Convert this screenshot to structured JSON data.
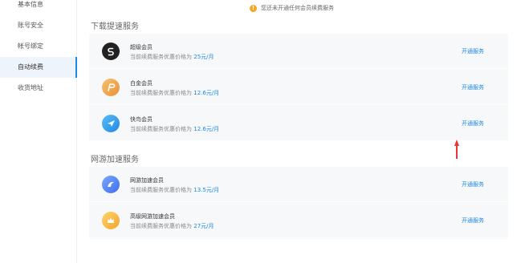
{
  "sidebar": {
    "items": [
      {
        "label": "基本信息",
        "active": false
      },
      {
        "label": "账号安全",
        "active": false
      },
      {
        "label": "帐号绑定",
        "active": false
      },
      {
        "label": "自动续费",
        "active": true
      },
      {
        "label": "收货地址",
        "active": false
      }
    ]
  },
  "notice": {
    "icon": "warning-icon",
    "text": "您还未开通任何会员续费服务"
  },
  "download_section": {
    "title": "下载提速服务",
    "rows": [
      {
        "name": "超级会员",
        "desc_prefix": "当前续费服务优惠价格为 ",
        "price": "25元/月",
        "action": "开通服务",
        "icon": "super-member-icon",
        "color": "#222222"
      },
      {
        "name": "白金会员",
        "desc_prefix": "当前续费服务优惠价格为 ",
        "price": "12.6元/月",
        "action": "开通服务",
        "icon": "platinum-member-icon",
        "color": "#f0a040"
      },
      {
        "name": "快鸟会员",
        "desc_prefix": "当前续费服务优惠价格为 ",
        "price": "12.6元/月",
        "action": "开通服务",
        "icon": "kuainiao-member-icon",
        "color": "#2e9cf0"
      }
    ]
  },
  "game_section": {
    "title": "网游加速服务",
    "rows": [
      {
        "name": "网游加速会员",
        "desc_prefix": "当前续费服务优惠价格为 ",
        "price": "13.5元/月",
        "action": "开通服务",
        "icon": "game-accel-icon",
        "color": "#4a7ff0"
      },
      {
        "name": "高级网游加速会员",
        "desc_prefix": "当前续费服务优惠价格为 ",
        "price": "27元/月",
        "action": "开通服务",
        "icon": "premium-game-accel-icon",
        "color": "#f5b940"
      }
    ]
  },
  "annotation": {
    "color": "#e53935",
    "icon": "red-arrow-up-icon"
  }
}
